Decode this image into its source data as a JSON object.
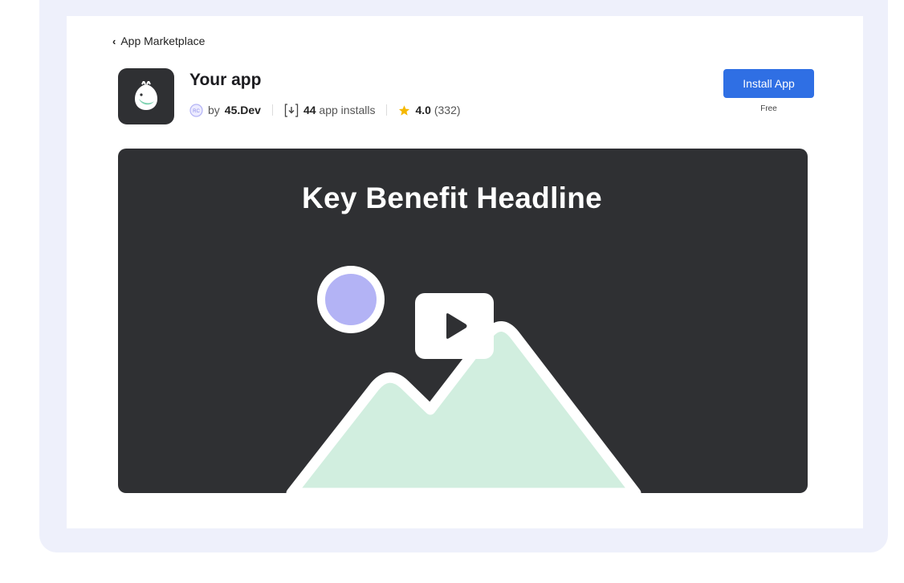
{
  "nav": {
    "back_label": "App Marketplace"
  },
  "app": {
    "name": "Your app",
    "developer_prefix": "by",
    "developer": "45.Dev",
    "installs_count": "44",
    "installs_label": "app installs",
    "rating": "4.0",
    "rating_count": "(332)"
  },
  "actions": {
    "install_label": "Install App",
    "price": "Free"
  },
  "media": {
    "headline": "Key Benefit Headline"
  },
  "colors": {
    "accent": "#2f6fe4",
    "frame": "#eef0fb",
    "media_bg": "#2f3033",
    "mountain": "#d1eedf",
    "sun": "#b3b3f5",
    "star": "#f5b800"
  }
}
